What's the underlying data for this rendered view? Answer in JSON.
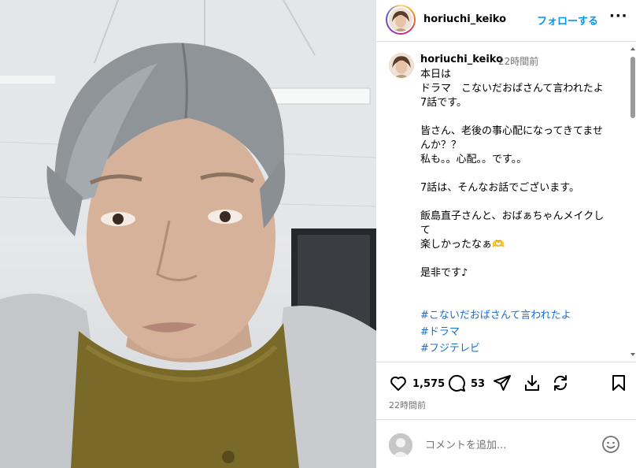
{
  "post": {
    "username": "horiuchi_keiko",
    "follow_label": "フォローする",
    "more_label": "···"
  },
  "caption": {
    "username": "horiuchi_keiko",
    "time": "22時間前",
    "text": "本日は\nドラマ　こないだおばさんて言われたよ\n7話です。\n\n皆さん、老後の事心配になってきてませんか？？\n私も。。心配。。です。。\n\n7話は、そんなお話でございます。\n\n飯島直子さんと、おばぁちゃんメイクして\n楽しかったなぁ🫶\n\n是非です♪",
    "hashtags": [
      "#こないだおばさんて言われたよ",
      "#ドラマ",
      "#フジテレビ"
    ]
  },
  "actions": {
    "likes": "1,575",
    "comments": "53",
    "posted_ago": "22時間前"
  },
  "comment_box": {
    "placeholder": "コメントを追加..."
  },
  "colors": {
    "accent": "#0095f6",
    "hashtag": "#1a6fd1",
    "muted": "#737373",
    "divider": "#dbdbdb"
  },
  "icons": [
    "heart-icon",
    "comment-icon",
    "share-icon",
    "save-download-icon",
    "repost-icon",
    "bookmark-icon",
    "emoji-icon",
    "more-icon"
  ]
}
